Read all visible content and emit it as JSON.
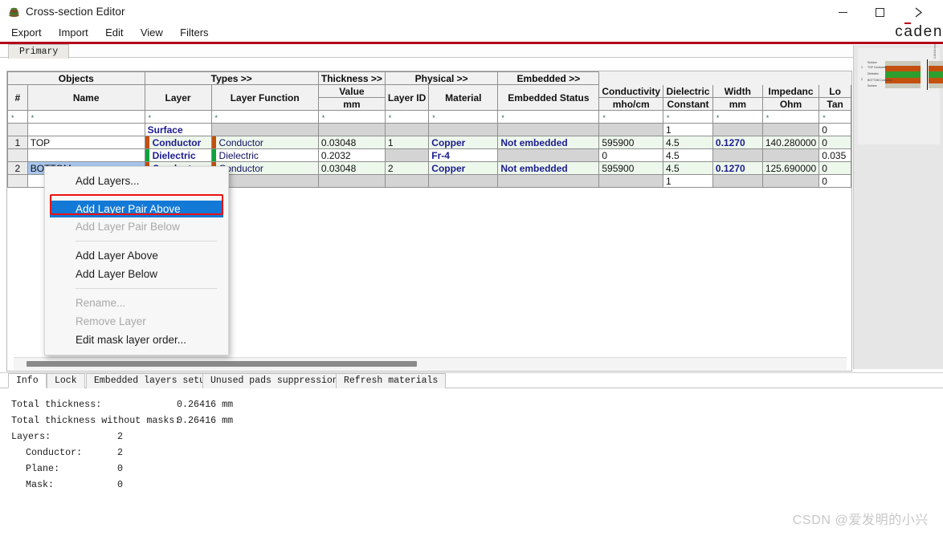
{
  "window": {
    "title": "Cross-section Editor",
    "icon": "stack-icon",
    "minimize": "—",
    "maximize": "□",
    "close": "✕"
  },
  "menubar": {
    "items": [
      "Export",
      "Import",
      "Edit",
      "View",
      "Filters"
    ]
  },
  "brand": {
    "pre": "c",
    "macron": "a",
    "post": "den"
  },
  "tabs": {
    "primary": "Primary"
  },
  "grid": {
    "group_headers": [
      {
        "label": "Objects"
      },
      {
        "label": "Types >>"
      },
      {
        "label": "Thickness >>"
      },
      {
        "label": "Physical >>"
      },
      {
        "label": "Embedded >>"
      }
    ],
    "columns": [
      {
        "label": "#",
        "unit": ""
      },
      {
        "label": "Name",
        "unit": ""
      },
      {
        "label": "Layer",
        "unit": ""
      },
      {
        "label": "Layer Function",
        "unit": ""
      },
      {
        "label": "Value",
        "unit": "mm"
      },
      {
        "label": "Layer ID",
        "unit": ""
      },
      {
        "label": "Material",
        "unit": ""
      },
      {
        "label": "Embedded Status",
        "unit": ""
      },
      {
        "label": "Conductivity",
        "unit": "mho/cm"
      },
      {
        "label": "Dielectric",
        "unit": "Constant"
      },
      {
        "label": "Width",
        "unit": "mm"
      },
      {
        "label": "Impedanc",
        "unit": "Ohm"
      },
      {
        "label": "Lo",
        "unit": "Tan"
      }
    ],
    "filter_marker": "*",
    "rows": [
      {
        "index": "",
        "name": "",
        "layer": "Surface",
        "marker": "none",
        "layer_function": "",
        "thickness": "",
        "layer_id": "",
        "material": "",
        "embedded_status": "",
        "conductivity": "",
        "dielectric_constant": "1",
        "width": "",
        "impedance": "",
        "loss_tangent": "0",
        "style": "gray"
      },
      {
        "index": "1",
        "name": "TOP",
        "layer": "Conductor",
        "marker": "conductor",
        "layer_function": "Conductor",
        "thickness": "0.03048",
        "layer_id": "1",
        "material": "Copper",
        "embedded_status": "Not embedded",
        "conductivity": "595900",
        "dielectric_constant": "4.5",
        "width": "0.1270",
        "impedance": "140.280000",
        "loss_tangent": "0",
        "style": "green"
      },
      {
        "index": "",
        "name": "",
        "layer": "Dielectric",
        "marker": "dielectric",
        "layer_function": "Dielectric",
        "thickness": "0.2032",
        "layer_id": "",
        "material": "Fr-4",
        "embedded_status": "",
        "conductivity": "0",
        "dielectric_constant": "4.5",
        "width": "",
        "impedance": "",
        "loss_tangent": "0.035",
        "style": "white"
      },
      {
        "index": "2",
        "name": "BOTTOM",
        "layer": "Conductor",
        "marker": "conductor",
        "layer_function": "Conductor",
        "thickness": "0.03048",
        "layer_id": "2",
        "material": "Copper",
        "embedded_status": "Not embedded",
        "conductivity": "595900",
        "dielectric_constant": "4.5",
        "width": "0.1270",
        "impedance": "125.690000",
        "loss_tangent": "0",
        "style": "green-selected"
      },
      {
        "index": "",
        "name": "",
        "layer": "",
        "marker": "none",
        "layer_function": "",
        "thickness": "",
        "layer_id": "",
        "material": "",
        "embedded_status": "",
        "conductivity": "",
        "dielectric_constant": "1",
        "width": "",
        "impedance": "",
        "loss_tangent": "0",
        "style": "gray"
      }
    ]
  },
  "context_menu": {
    "items": [
      {
        "label": "Add Layers...",
        "state": "normal"
      },
      {
        "label": "Add Layer Pair Above",
        "state": "highlighted"
      },
      {
        "label": "Add Layer Pair Below",
        "state": "disabled"
      },
      {
        "label": "Add Layer Above",
        "state": "normal"
      },
      {
        "label": "Add Layer Below",
        "state": "normal"
      },
      {
        "label": "Rename...",
        "state": "disabled"
      },
      {
        "label": "Remove Layer",
        "state": "disabled"
      },
      {
        "label": "Edit mask layer order...",
        "state": "normal"
      }
    ]
  },
  "preview": {
    "labels": [
      "Surface",
      "TOP Conductor",
      "Dielectric",
      "BOTTOM Conductor",
      "Surface"
    ],
    "indices": [
      "",
      "1",
      "",
      "2",
      ""
    ],
    "side_text": "0.26416 mm"
  },
  "info_panel": {
    "tabs": [
      "Info",
      "Lock",
      "Embedded layers setup",
      "Unused pads suppression",
      "Refresh materials"
    ],
    "active_tab": "Info",
    "rows": [
      {
        "label": "Total thickness:",
        "value": "0.26416 mm",
        "indent": false
      },
      {
        "label": "Total thickness without masks:",
        "value": "0.26416 mm",
        "indent": false
      },
      {
        "label": "Layers:",
        "value": "2",
        "indent": false
      },
      {
        "label": "Conductor:",
        "value": "2",
        "indent": true
      },
      {
        "label": "Plane:",
        "value": "0",
        "indent": true
      },
      {
        "label": "Mask:",
        "value": "0",
        "indent": true
      }
    ]
  },
  "watermark": "CSDN @爱发明的小兴",
  "colors": {
    "accent_red": "#b3001b",
    "conductor": "#c4500e",
    "dielectric": "#0aa33c",
    "highlight_blue": "#1379d6",
    "selection_blue": "#a8c6ef",
    "callout_red": "#ee1111"
  }
}
